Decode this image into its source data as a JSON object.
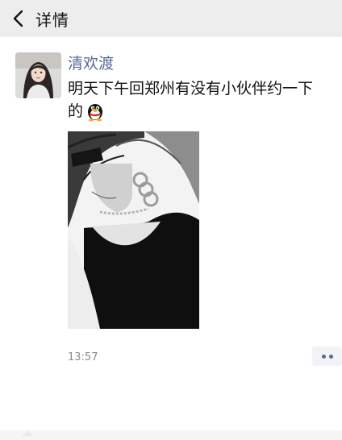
{
  "header": {
    "title": "详情",
    "back_icon": "chevron-left-icon"
  },
  "post": {
    "author": "清欢渡",
    "text_line1": "明天下午回郑州有没有小伙伴约一下",
    "text_line2": "的",
    "emoji": "qq-penguin-emoji",
    "photo": "black-and-white-portrait-photo",
    "time": "13:57",
    "more_icon": "more-dots-icon"
  },
  "colors": {
    "header_bg": "#ededed",
    "name_link": "#576b95",
    "text": "#111111",
    "time": "#8a8a8a",
    "more_bg": "#f2f3f6"
  }
}
